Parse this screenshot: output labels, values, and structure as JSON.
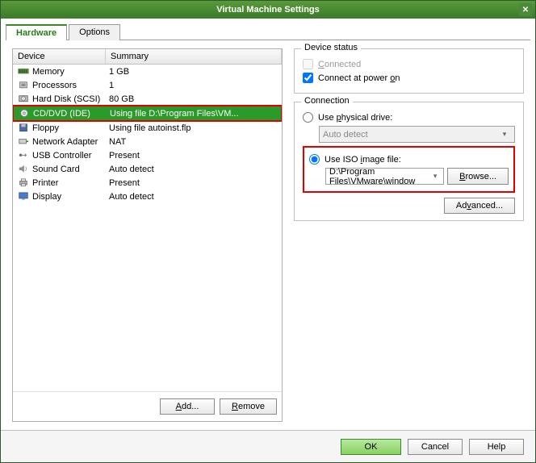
{
  "window": {
    "title": "Virtual Machine Settings"
  },
  "tabs": {
    "hardware": "Hardware",
    "options": "Options"
  },
  "table": {
    "headers": {
      "device": "Device",
      "summary": "Summary"
    },
    "rows": [
      {
        "device": "Memory",
        "summary": "1 GB",
        "icon": "memory"
      },
      {
        "device": "Processors",
        "summary": "1",
        "icon": "cpu"
      },
      {
        "device": "Hard Disk (SCSI)",
        "summary": "80 GB",
        "icon": "hdd"
      },
      {
        "device": "CD/DVD (IDE)",
        "summary": "Using file D:\\Program Files\\VM...",
        "icon": "cd",
        "selected": true
      },
      {
        "device": "Floppy",
        "summary": "Using file autoinst.flp",
        "icon": "floppy"
      },
      {
        "device": "Network Adapter",
        "summary": "NAT",
        "icon": "net"
      },
      {
        "device": "USB Controller",
        "summary": "Present",
        "icon": "usb"
      },
      {
        "device": "Sound Card",
        "summary": "Auto detect",
        "icon": "sound"
      },
      {
        "device": "Printer",
        "summary": "Present",
        "icon": "printer"
      },
      {
        "device": "Display",
        "summary": "Auto detect",
        "icon": "display"
      }
    ]
  },
  "leftButtons": {
    "add": "Add...",
    "remove": "Remove"
  },
  "deviceStatus": {
    "legend": "Device status",
    "connected": "Connected",
    "connectAtPowerOn": "Connect at power on"
  },
  "connection": {
    "legend": "Connection",
    "usePhysical": "Use physical drive:",
    "physicalValue": "Auto detect",
    "useIso": "Use ISO image file:",
    "isoValue": "D:\\Program Files\\VMware\\window",
    "browse": "Browse...",
    "advanced": "Advanced..."
  },
  "footer": {
    "ok": "OK",
    "cancel": "Cancel",
    "help": "Help"
  }
}
